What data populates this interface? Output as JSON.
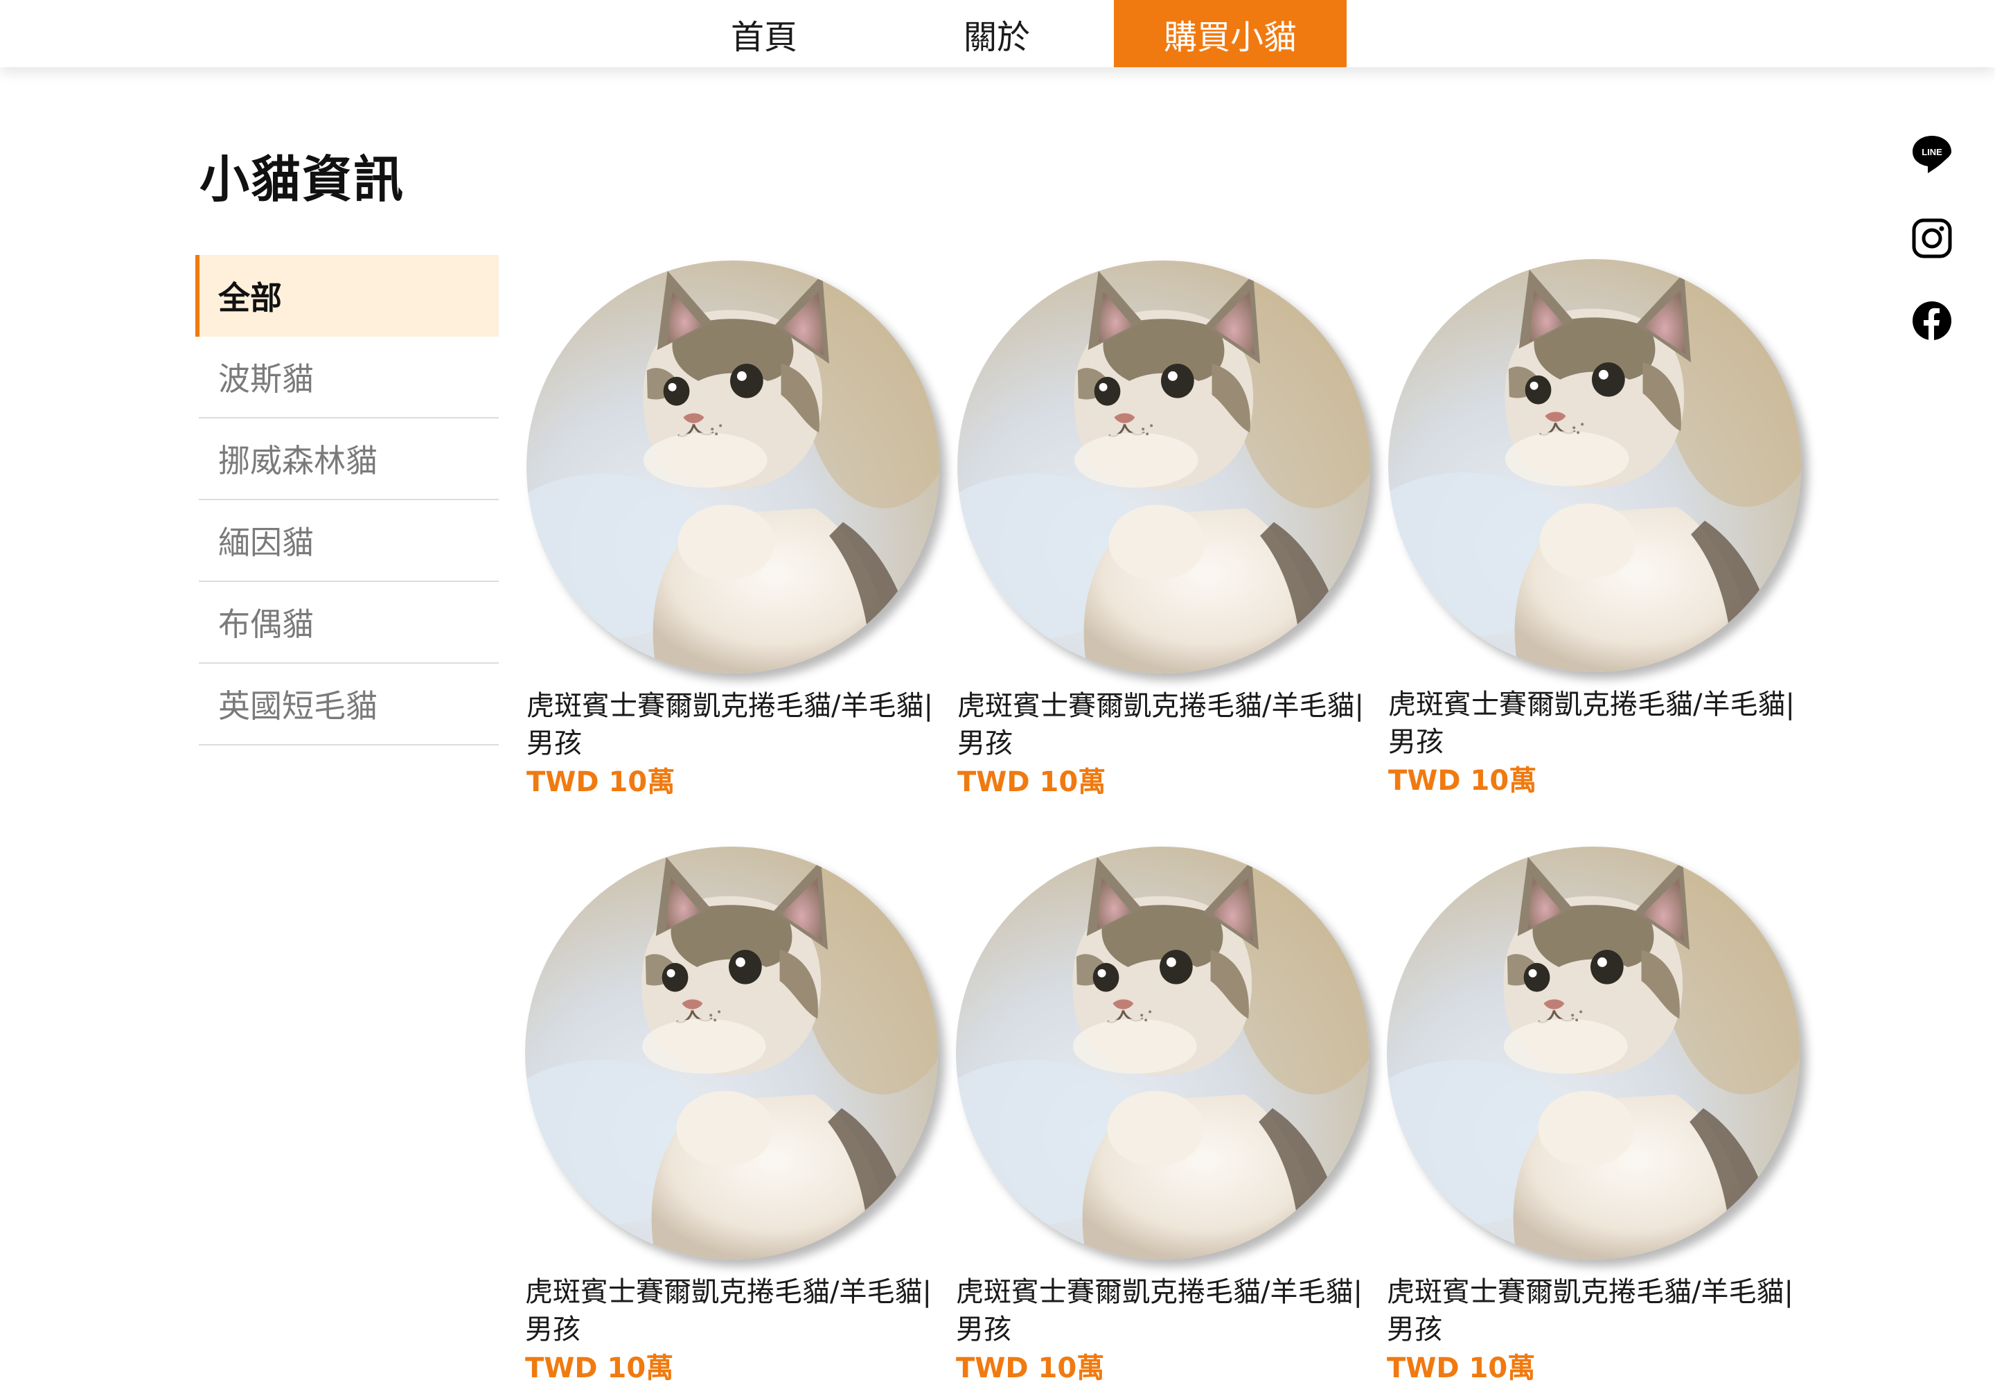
{
  "nav": {
    "home": "首頁",
    "about": "關於",
    "buy": "購買小貓"
  },
  "page": {
    "title": "小貓資訊"
  },
  "sidebar": {
    "items": [
      {
        "label": "全部",
        "active": true
      },
      {
        "label": "波斯貓"
      },
      {
        "label": "挪威森林貓"
      },
      {
        "label": "緬因貓"
      },
      {
        "label": "布偶貓"
      },
      {
        "label": "英國短毛貓"
      }
    ]
  },
  "products": [
    {
      "name_line1": "虎斑賓士賽爾凱克捲毛貓/羊毛貓|",
      "name_line2": "男孩",
      "price": "TWD 10萬"
    },
    {
      "name_line1": "虎斑賓士賽爾凱克捲毛貓/羊毛貓|",
      "name_line2": "男孩",
      "price": "TWD 10萬"
    },
    {
      "name_line1": "虎斑賓士賽爾凱克捲毛貓/羊毛貓|",
      "name_line2": "男孩",
      "price": "TWD 10萬"
    },
    {
      "name_line1": "虎斑賓士賽爾凱克捲毛貓/羊毛貓|",
      "name_line2": "男孩",
      "price": "TWD 10萬"
    },
    {
      "name_line1": "虎斑賓士賽爾凱克捲毛貓/羊毛貓|",
      "name_line2": "男孩",
      "price": "TWD 10萬"
    },
    {
      "name_line1": "虎斑賓士賽爾凱克捲毛貓/羊毛貓|",
      "name_line2": "男孩",
      "price": "TWD 10萬"
    }
  ],
  "social": {
    "line": {
      "icon": "line-icon",
      "text": "LINE"
    },
    "instagram": {
      "icon": "instagram-icon"
    },
    "facebook": {
      "icon": "facebook-icon"
    }
  },
  "colors": {
    "accent": "#f07a10",
    "active_bg": "#fff0db",
    "muted_text": "#7a7a7a"
  }
}
